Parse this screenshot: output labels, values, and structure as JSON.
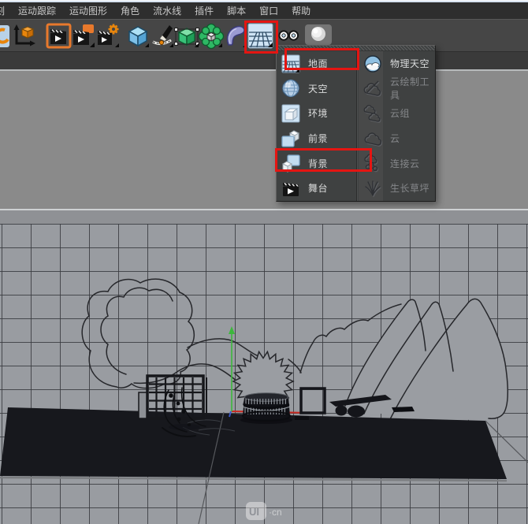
{
  "menubar": {
    "items": [
      "刻",
      "运动跟踪",
      "运动图形",
      "角色",
      "流水线",
      "插件",
      "脚本",
      "窗口",
      "帮助"
    ]
  },
  "toolbar": {
    "icon_names": [
      "undo",
      "coordinates",
      "render-view",
      "render-to-picture-viewer",
      "render-settings",
      "add-cube",
      "pen-spline",
      "subdivision-surface",
      "array",
      "bend-deformer",
      "floor-objects",
      "camera",
      "light"
    ]
  },
  "object_menu": {
    "left_items": [
      {
        "label": "地面",
        "highlighted": true
      },
      {
        "label": "天空",
        "highlighted": false
      },
      {
        "label": "环境",
        "highlighted": false
      },
      {
        "label": "前景",
        "highlighted": false
      },
      {
        "label": "背景",
        "highlighted": true
      },
      {
        "label": "舞台",
        "highlighted": false
      }
    ],
    "right_items": [
      {
        "label": "物理天空",
        "enabled": true
      },
      {
        "label": "云绘制工具",
        "enabled": false
      },
      {
        "label": "云组",
        "enabled": false
      },
      {
        "label": "云",
        "enabled": false
      },
      {
        "label": "连接云",
        "enabled": false
      },
      {
        "label": "生长草坪",
        "enabled": false
      }
    ]
  },
  "viewport": {
    "watermark_badge": "UI",
    "watermark_suffix": "·cn"
  },
  "colors": {
    "highlight_red": "#e41512",
    "toolbar_bg": "#464646",
    "menu_bg": "#3f4141",
    "viewport_gray": "#999ca1",
    "floor_black": "#17181d",
    "axis_green": "#3cb83c",
    "axis_red": "#c92820"
  }
}
